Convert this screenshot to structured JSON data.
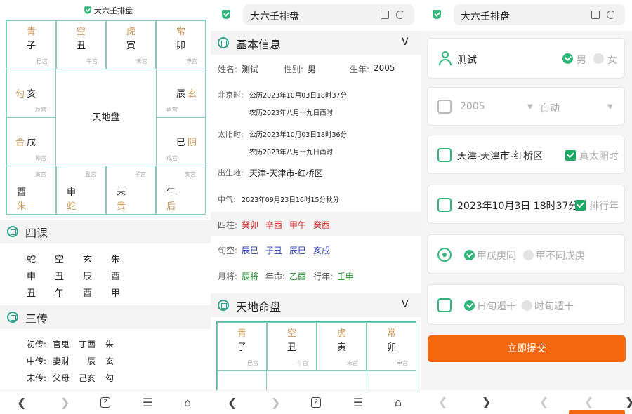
{
  "p1": {
    "title": "大六壬排盘",
    "board": {
      "top": [
        {
          "god": "青",
          "branch": "子",
          "palace": "巳宫"
        },
        {
          "god": "空",
          "branch": "丑",
          "palace": "午宫"
        },
        {
          "god": "虎",
          "branch": "寅",
          "palace": "未宫"
        },
        {
          "god": "常",
          "branch": "卯",
          "palace": "申宫"
        }
      ],
      "left": [
        {
          "god": "勾",
          "branch": "亥",
          "palace": "辰宫"
        },
        {
          "god": "合",
          "branch": "戌",
          "palace": "卯宫"
        }
      ],
      "right": [
        {
          "god": "玄",
          "branch": "辰",
          "palace": "酉宫"
        },
        {
          "god": "阴",
          "branch": "巳",
          "palace": "戌宫"
        }
      ],
      "bottom": [
        {
          "god": "朱",
          "branch": "酉",
          "palace": "寅宫"
        },
        {
          "god": "蛇",
          "branch": "申",
          "palace": "丑宫"
        },
        {
          "god": "贵",
          "branch": "未",
          "palace": "子宫"
        },
        {
          "god": "后",
          "branch": "午",
          "palace": "亥宫"
        }
      ],
      "center": "天地盘"
    },
    "sike_title": "四课",
    "sike": [
      [
        "蛇",
        "空",
        "玄",
        "朱"
      ],
      [
        "申",
        "丑",
        "辰",
        "酉"
      ],
      [
        "丑",
        "午",
        "酉",
        "甲"
      ]
    ],
    "sanchuan_title": "三传",
    "sanchuan": [
      {
        "label": "初传:",
        "rel": "官鬼",
        "gz": "丁酉",
        "god": "朱"
      },
      {
        "label": "中传:",
        "rel": "妻财",
        "gz": "辰",
        "god": "玄"
      },
      {
        "label": "末传:",
        "rel": "父母",
        "gz": "己亥",
        "god": "勾"
      }
    ],
    "tabcount": "2"
  },
  "p2": {
    "url": "大六壬排盘",
    "basic_title": "基本信息",
    "chev": "V",
    "name_label": "姓名:",
    "name": "测试",
    "sex_label": "性别:",
    "sex": "男",
    "year_label": "生年:",
    "year": "2005",
    "bj_label": "北京时:",
    "bj_solar": "公历2023年10月03日18时37分",
    "bj_lunar": "农历2023年八月十九日酉时",
    "ty_label": "太阳时:",
    "ty_solar": "公历2023年10月03日18时36分",
    "ty_lunar": "农历2023年八月十九日酉时",
    "place_label": "出生地:",
    "place": "天津-天津市-红桥区",
    "qi_label": "中气:",
    "qi": "2023年09月23日16时15分秋分",
    "sizhu_label": "四柱:",
    "sizhu": [
      "癸卯",
      "辛酉",
      "甲午",
      "癸酉"
    ],
    "xunkong_label": "旬空:",
    "xunkong": [
      "辰巳",
      "子丑",
      "辰巳",
      "亥戌"
    ],
    "yuejiang_label": "月将:",
    "yuejiang": "辰将",
    "ming_label": "年命:",
    "ming": "乙酉",
    "xing_label": "行年:",
    "xing": "壬申",
    "pan_title": "天地命盘",
    "pan_top": [
      {
        "god": "青",
        "branch": "子",
        "palace": "巳宫"
      },
      {
        "god": "空",
        "branch": "丑",
        "palace": "午宫"
      },
      {
        "god": "虎",
        "branch": "寅",
        "palace": "未宫"
      },
      {
        "god": "常",
        "branch": "卯",
        "palace": "申宫"
      }
    ],
    "tabcount": "2"
  },
  "p3": {
    "url": "大六壬排盘",
    "name": "测试",
    "male": "男",
    "female": "女",
    "year": "2005",
    "mode": "自动",
    "place": "天津-天津市-红桥区",
    "true_sun": "真太阳时",
    "datetime": "2023年10月3日 18时37分",
    "row_year": "排行年",
    "opt1a": "甲戊庚同",
    "opt1b": "甲不同戊庚",
    "opt2a": "日旬遁干",
    "opt2b": "时旬遁干",
    "submit": "立即提交"
  },
  "colors": {
    "accent": "#2fb67a",
    "red": "#d32424",
    "blue": "#2a3fb0",
    "green": "#1f8f2a",
    "orange": "#f5670d",
    "gold": "#c89656"
  }
}
